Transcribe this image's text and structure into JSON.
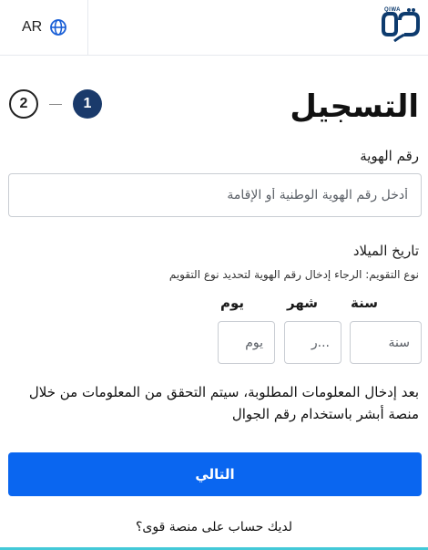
{
  "header": {
    "language_label": "AR",
    "language_icon": "globe-icon",
    "logo_icon": "qiwa-logo",
    "logo_text": "QIWA"
  },
  "page": {
    "title": "التسجيل",
    "steps": [
      "1",
      "2"
    ],
    "current_step": "1"
  },
  "id_field": {
    "label": "رقم الهوية",
    "placeholder": "أدخل رقم الهوية الوطنية أو الإقامة"
  },
  "birth_date": {
    "label": "تاريخ الميلاد",
    "hint": "نوع التقويم: الرجاء إدخال رقم الهوية لتحديد نوع التقويم",
    "year_label": "سنة",
    "year_placeholder": "سنة",
    "month_label": "شهر",
    "month_placeholder": "...ر",
    "day_label": "يوم",
    "day_placeholder": "يوم"
  },
  "info_text": "بعد إدخال المعلومات المطلوبة، سيتم التحقق من المعلومات من خلال منصة أبشر باستخدام رقم الجوال",
  "next_button": "التالي",
  "account_link": "لديك حساب على منصة قوى؟",
  "colors": {
    "primary_button": "#0a66f0",
    "active_step": "#1a3a6b",
    "accent_bar": "#43c9d8",
    "logo": "#0d3b6e"
  }
}
